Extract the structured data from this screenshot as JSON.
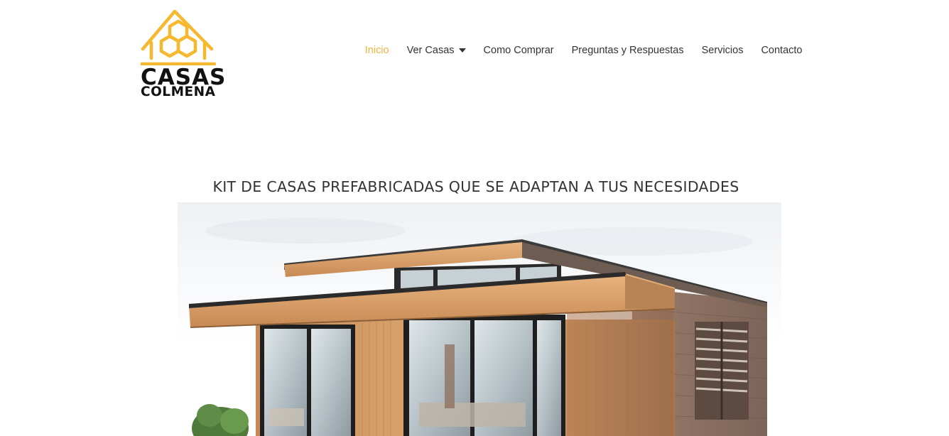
{
  "brand": {
    "line1": "CASAS",
    "line2": "COLMENA",
    "accent_color": "#f5b82e",
    "icon": "honeycomb-house-icon"
  },
  "nav": {
    "items": [
      {
        "label": "Inicio",
        "active": true
      },
      {
        "label": "Ver Casas",
        "has_dropdown": true
      },
      {
        "label": "Como Comprar"
      },
      {
        "label": "Preguntas y Respuestas"
      },
      {
        "label": "Servicios"
      },
      {
        "label": "Contacto"
      }
    ],
    "active_color": "#f0b540",
    "dropdown_icon": "caret-down-icon"
  },
  "hero": {
    "headline": "KIT DE CASAS PREFABRICADAS QUE SE ADAPTAN A TUS NECESIDADES",
    "image_subject": "prefab-wooden-house-image"
  }
}
